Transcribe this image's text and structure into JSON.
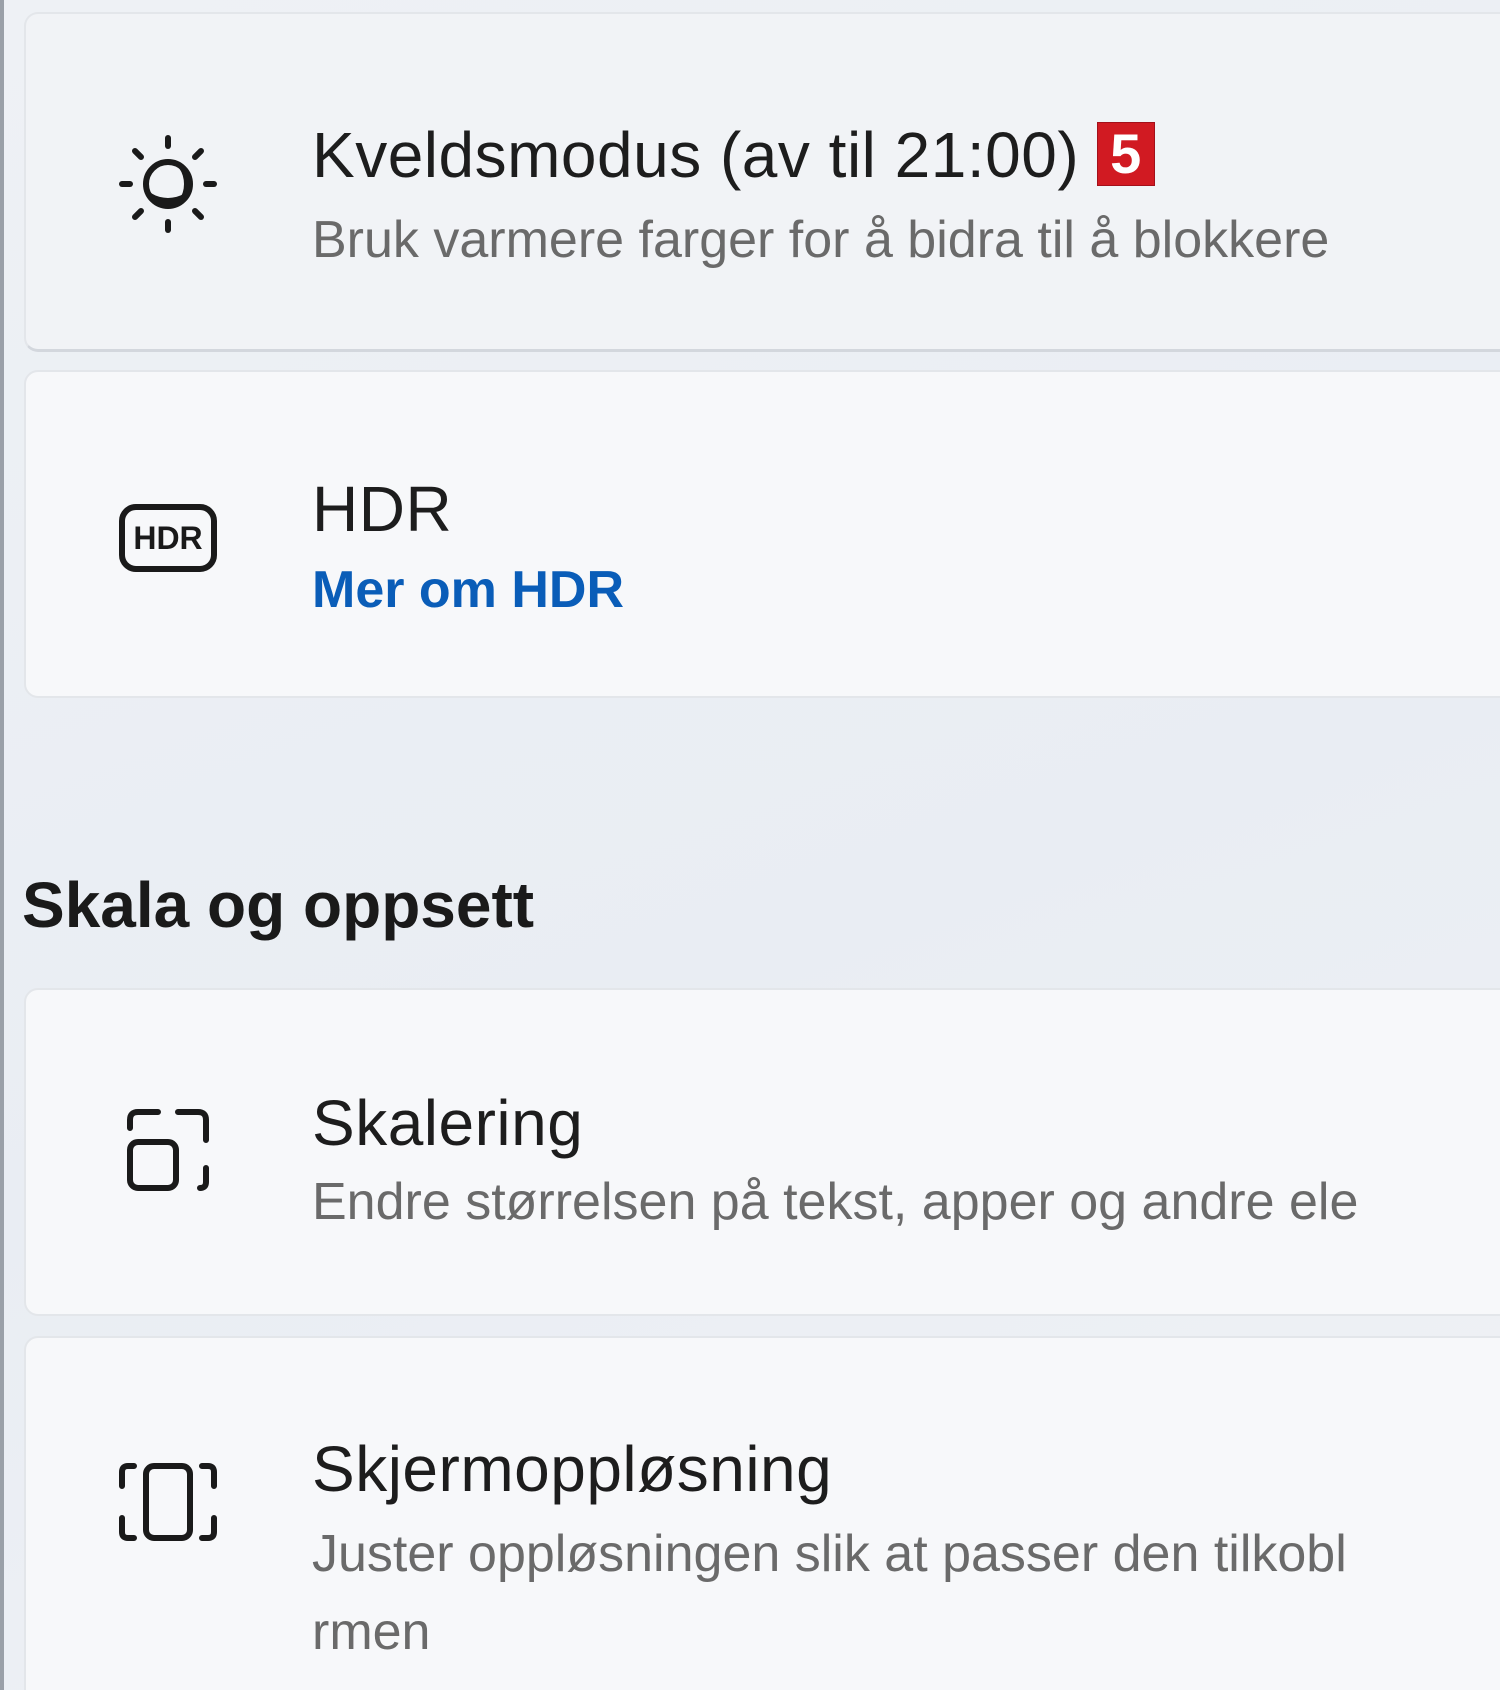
{
  "cards": {
    "night_mode": {
      "title": "Kveldsmodus (av til 21:00)",
      "badge": "5",
      "description": "Bruk varmere farger for å bidra til å blokkere",
      "icon": "brightness-icon"
    },
    "hdr": {
      "title": "HDR",
      "link": "Mer om HDR",
      "icon_label": "HDR",
      "icon": "hdr-icon"
    },
    "scaling": {
      "title": "Skalering",
      "description": "Endre størrelsen på tekst, apper og andre ele",
      "icon": "scale-icon"
    },
    "resolution": {
      "title": "Skjermoppløsning",
      "description_line1": "Juster oppløsningen slik at passer den tilkobl",
      "description_line2": "rmen",
      "icon": "resolution-icon"
    }
  },
  "section": {
    "heading": "Skala og oppsett"
  },
  "colors": {
    "link": "#0a5db8",
    "badge": "#d11a22"
  }
}
